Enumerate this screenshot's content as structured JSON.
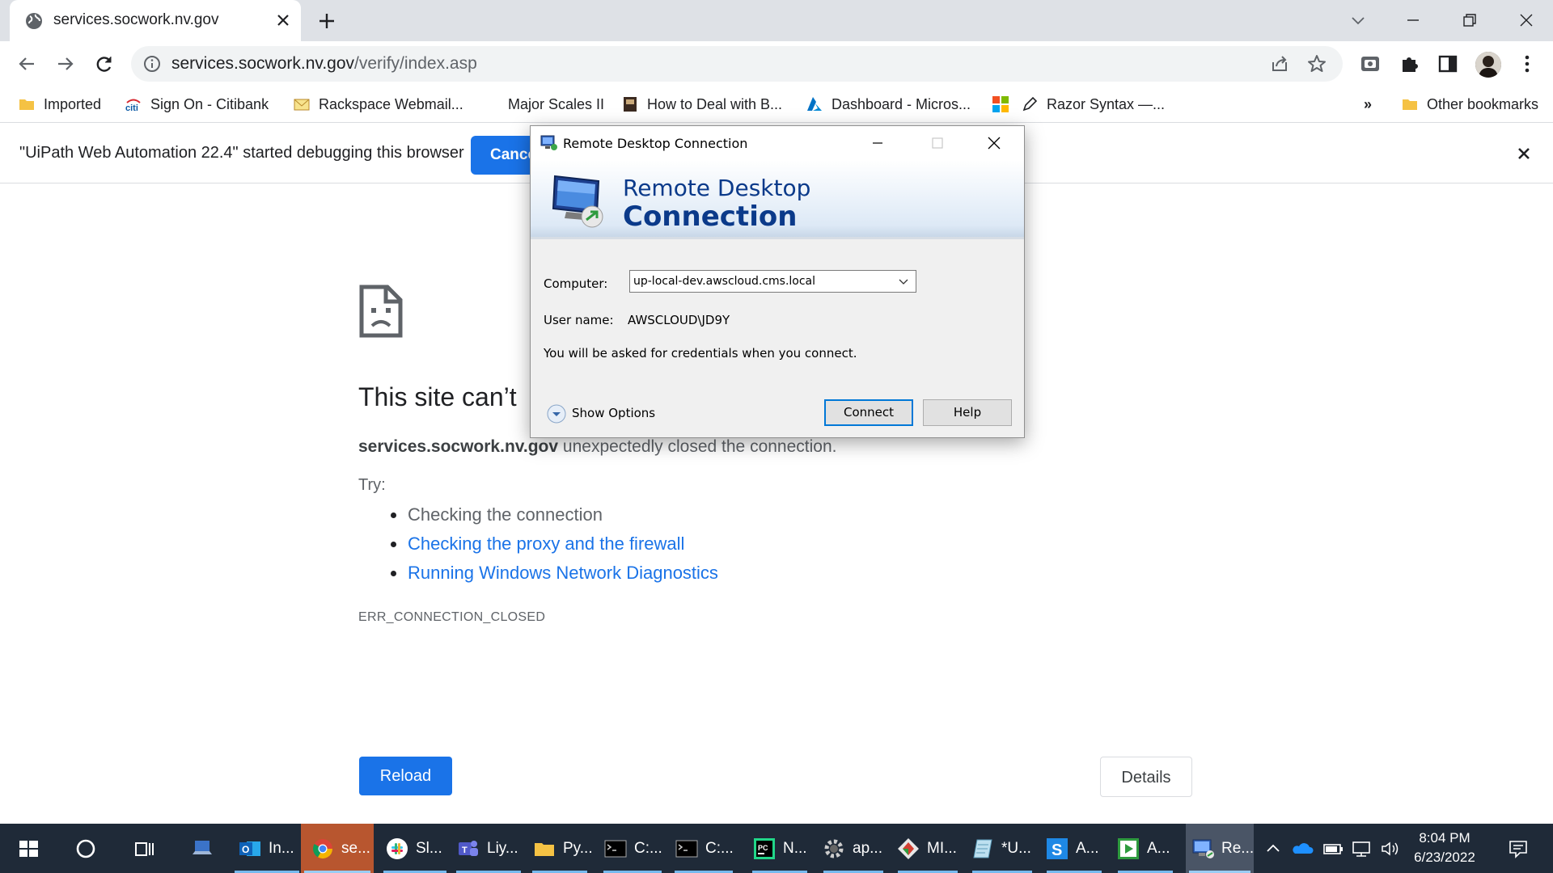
{
  "browser": {
    "tab": {
      "title": "services.socwork.nv.gov"
    },
    "omnibox": {
      "url_host": "services.socwork.nv.gov",
      "url_path": "/verify/index.asp"
    },
    "bookmarks": [
      {
        "label": "Imported",
        "icon": "folder-icon"
      },
      {
        "label": "Sign On - Citibank",
        "icon": "citi-icon"
      },
      {
        "label": "Rackspace Webmail...",
        "icon": "mail-icon"
      },
      {
        "label": "Major Scales II",
        "icon": ""
      },
      {
        "label": "How to Deal with B...",
        "icon": "book-icon"
      },
      {
        "label": "Dashboard - Micros...",
        "icon": "azure-icon"
      },
      {
        "label": "",
        "icon": "microsoft-icon"
      },
      {
        "label": "Razor Syntax —...",
        "icon": "pen-icon"
      }
    ],
    "bookmarks_overflow": "»",
    "other_bookmarks": "Other bookmarks",
    "infobar": {
      "message": "\"UiPath Web Automation 22.4\" started debugging this browser",
      "cancel_label": "Cance"
    }
  },
  "error_page": {
    "title": "This site can’t",
    "desc_host": "services.socwork.nv.gov",
    "desc_rest": " unexpectedly closed the connection.",
    "try_label": "Try:",
    "suggestions": [
      {
        "text": "Checking the connection",
        "link": false
      },
      {
        "text": "Checking the proxy and the firewall",
        "link": true
      },
      {
        "text": "Running Windows Network Diagnostics",
        "link": true
      }
    ],
    "error_code": "ERR_CONNECTION_CLOSED",
    "reload_label": "Reload",
    "details_label": "Details"
  },
  "rdp_dialog": {
    "window_title": "Remote Desktop Connection",
    "banner_line1": "Remote Desktop",
    "banner_line2": "Connection",
    "computer_label": "Computer:",
    "computer_value": "up-local-dev.awscloud.cms.local",
    "username_label": "User name:",
    "username_value": "AWSCLOUD\\JD9Y",
    "credentials_note": "You will be asked for credentials when you connect.",
    "show_options_label": "Show Options",
    "connect_label": "Connect",
    "help_label": "Help"
  },
  "taskbar": {
    "items": [
      {
        "label": "In...",
        "icon": "outlook-icon"
      },
      {
        "label": "se...",
        "icon": "chrome-icon"
      },
      {
        "label": "Sl...",
        "icon": "slack-icon"
      },
      {
        "label": "Liy...",
        "icon": "teams-icon"
      },
      {
        "label": "Py...",
        "icon": "folder-icon"
      },
      {
        "label": "C:...",
        "icon": "cmd-icon"
      },
      {
        "label": "C:...",
        "icon": "cmd-icon"
      },
      {
        "label": "N...",
        "icon": "pycharm-icon"
      },
      {
        "label": "ap...",
        "icon": "gear-app-icon"
      },
      {
        "label": "MI...",
        "icon": "diamond-app-icon"
      },
      {
        "label": "*U...",
        "icon": "notepad-icon"
      },
      {
        "label": "A...",
        "icon": "s-app-icon"
      },
      {
        "label": "A...",
        "icon": "play-app-icon"
      },
      {
        "label": "Re...",
        "icon": "rdp-icon"
      }
    ],
    "clock_time": "8:04 PM",
    "clock_date": "6/23/2022"
  },
  "colors": {
    "accent_blue": "#1a73e8",
    "taskbar_bg": "#1f2a38",
    "rdp_title_blue": "#0b3a8a"
  }
}
